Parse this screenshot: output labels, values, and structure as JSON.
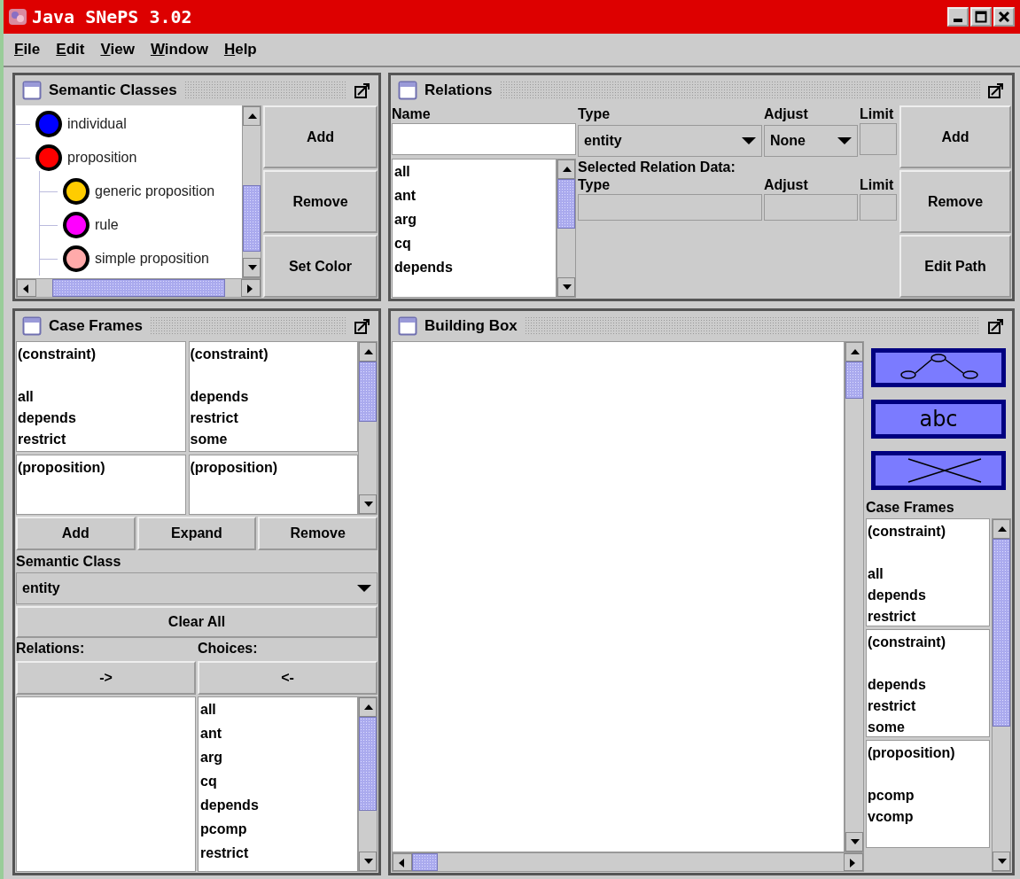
{
  "window": {
    "title": "Java SNePS 3.02"
  },
  "menu": [
    "File",
    "Edit",
    "View",
    "Window",
    "Help"
  ],
  "semantic_classes": {
    "title": "Semantic Classes",
    "tree": [
      {
        "label": "individual",
        "color": "#0000ff"
      },
      {
        "label": "proposition",
        "color": "#ff0000",
        "children": [
          {
            "label": "generic proposition",
            "color": "#ffcc00"
          },
          {
            "label": "rule",
            "color": "#ff00ff"
          },
          {
            "label": "simple proposition",
            "color": "#ffaaaa"
          }
        ]
      }
    ],
    "buttons": [
      "Add",
      "Remove",
      "Set Color"
    ]
  },
  "relations": {
    "title": "Relations",
    "name_label": "Name",
    "type_label": "Type",
    "adjust_label": "Adjust",
    "limit_label": "Limit",
    "type_value": "entity",
    "adjust_value": "None",
    "list": [
      "all",
      "ant",
      "arg",
      "cq",
      "depends"
    ],
    "selected_label": "Selected Relation Data:",
    "selected_type_label": "Type",
    "selected_adjust_label": "Adjust",
    "selected_limit_label": "Limit",
    "buttons": [
      "Add",
      "Remove",
      "Edit Path"
    ]
  },
  "case_frames": {
    "title": "Case Frames",
    "frames": [
      {
        "class": "(constraint)",
        "relations": [
          "all",
          "depends",
          "restrict"
        ]
      },
      {
        "class": "(constraint)",
        "relations": [
          "depends",
          "restrict",
          "some"
        ]
      },
      {
        "class": "(proposition)"
      },
      {
        "class": "(proposition)"
      }
    ],
    "buttons": [
      "Add",
      "Expand",
      "Remove"
    ],
    "semantic_class_label": "Semantic Class",
    "semantic_class_value": "entity",
    "clear_button": "Clear All",
    "relations_label": "Relations:",
    "choices_label": "Choices:",
    "add_arrow": "->",
    "remove_arrow": "<-",
    "choices": [
      "all",
      "ant",
      "arg",
      "cq",
      "depends",
      "pcomp",
      "restrict"
    ]
  },
  "building_box": {
    "title": "Building Box",
    "tools": [
      {
        "kind": "tree"
      },
      {
        "kind": "text",
        "label": "abc"
      },
      {
        "kind": "cross"
      }
    ],
    "case_frames_label": "Case Frames",
    "frames": [
      {
        "class": "(constraint)",
        "relations": [
          "all",
          "depends",
          "restrict"
        ]
      },
      {
        "class": "(constraint)",
        "relations": [
          "depends",
          "restrict",
          "some"
        ]
      },
      {
        "class": "(proposition)",
        "relations": [
          "pcomp",
          "vcomp"
        ]
      }
    ]
  }
}
